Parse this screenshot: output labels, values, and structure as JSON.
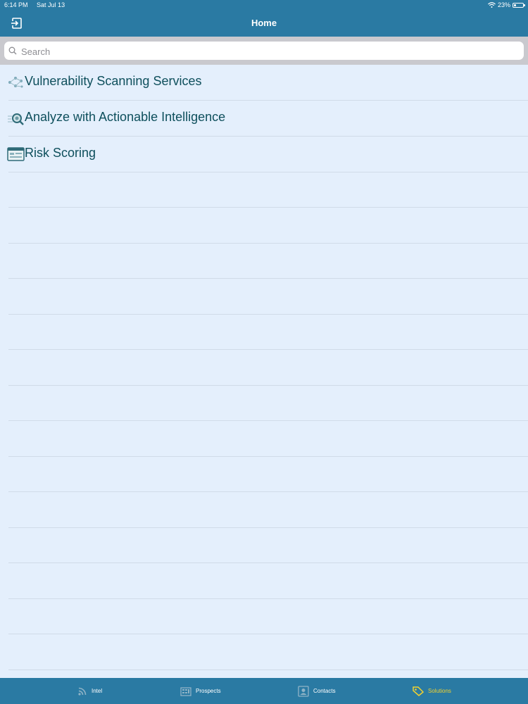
{
  "status": {
    "time": "6:14 PM",
    "date": "Sat Jul 13",
    "battery": "23%",
    "battery_level": 0.23
  },
  "header": {
    "title": "Home",
    "logout_icon": "logout-icon"
  },
  "search": {
    "placeholder": "Search",
    "value": ""
  },
  "items": [
    {
      "label": "Vulnerability Scanning Services",
      "icon": "network-scan-icon"
    },
    {
      "label": "Analyze with Actionable Intelligence",
      "icon": "magnifier-icon"
    },
    {
      "label": "Risk Scoring",
      "icon": "dashboard-icon"
    }
  ],
  "tabs": [
    {
      "label": "Intel",
      "icon": "rss-icon",
      "active": false
    },
    {
      "label": "Prospects",
      "icon": "building-icon",
      "active": false
    },
    {
      "label": "Contacts",
      "icon": "contact-card-icon",
      "active": false
    },
    {
      "label": "Solutions",
      "icon": "tag-icon",
      "active": true
    }
  ],
  "colors": {
    "bar": "#2a7aa3",
    "background": "#e4effc",
    "active_tab": "#f2d22e",
    "item_text": "#0e4f5c"
  }
}
